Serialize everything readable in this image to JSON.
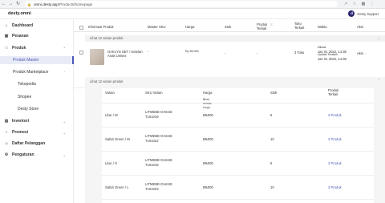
{
  "browser": {
    "url_host": "omni.desty.app",
    "url_path": "/Products/homepage",
    "icons": [
      "back-icon",
      "forward-icon",
      "reload-icon",
      "lock-icon",
      "share-icon",
      "star-icon",
      "extensions-icon",
      "menu-icon"
    ]
  },
  "header": {
    "logo": "desty.omni",
    "user_initial": "d",
    "user_name": "Desty Support"
  },
  "sidebar": {
    "items": [
      {
        "label": "Dashboard",
        "icon": "home-icon"
      },
      {
        "label": "Pesanan",
        "icon": "cart-icon"
      },
      {
        "label": "Produk",
        "icon": "box-icon"
      },
      {
        "label": "Produk Master"
      },
      {
        "label": "Produk Marketplace"
      },
      {
        "label": "Tokopedia"
      },
      {
        "label": "Shopee"
      },
      {
        "label": "Desty Store"
      },
      {
        "label": "Inventori",
        "icon": "inventory-icon"
      },
      {
        "label": "Promosi",
        "icon": "tag-icon"
      },
      {
        "label": "Daftar Pelanggan",
        "icon": "users-icon"
      },
      {
        "label": "Pengaturan",
        "icon": "gear-icon"
      }
    ]
  },
  "table": {
    "headers": {
      "info": "Informasi Produk",
      "sku": "Master SKU",
      "harga": "Harga",
      "stok": "Stok",
      "produk_terkait": "Produk Terkait",
      "toko_terkait": "Toko Terkait",
      "waktu": "Waktu",
      "aksi": "Aksi"
    },
    "group_label": "Lihat 12 varian produk",
    "product": {
      "name_line1": "OAKLYN SET / Setelan",
      "name_line2": "Anak Unisex",
      "sku": "-",
      "harga": "Rp 89.000",
      "stok": "-",
      "produk_terkait": "-",
      "toko_terkait": "3 Toko",
      "dibuat_label": "Dibuat",
      "dibuat_time": "Jan 01 2022, 14:38",
      "update_label": "Update Terakhir",
      "update_time": "Jan 01 2022, 14:38",
      "aksi": "Aksi"
    },
    "variant_panel_label": "Lihat 12 varian produk",
    "variant_headers": {
      "varian": "Varian",
      "sku_varian": "SKU Varian",
      "harga": "Harga",
      "ubah_harga": "Ubah semua harga",
      "stok": "Stok",
      "produk_terkait": "Produk Terkait"
    },
    "variants": [
      {
        "varian": "Lilac / M",
        "sku_line1": "LITMEBE-OAKSE",
        "sku_line2": "T101019",
        "harga": "89.000",
        "stok": "5",
        "produk_terkait": "3 Produk"
      },
      {
        "varian": "Safari Green / M",
        "sku_line1": "LITMEBE-OAKSE",
        "sku_line2": "T101022",
        "harga": "89.000",
        "stok": "10",
        "produk_terkait": "3 Produk"
      },
      {
        "varian": "Lilac / S",
        "sku_line1": "LITMEBE-OAKSE",
        "sku_line2": "T101018",
        "harga": "89.000",
        "stok": "5",
        "produk_terkait": "3 Produk"
      },
      {
        "varian": "Safari Green / L",
        "sku_line1": "LITMEBE-OAKSE",
        "sku_line2": "T101023",
        "harga": "89.000",
        "stok": "10",
        "produk_terkait": "3 Produk"
      }
    ]
  }
}
